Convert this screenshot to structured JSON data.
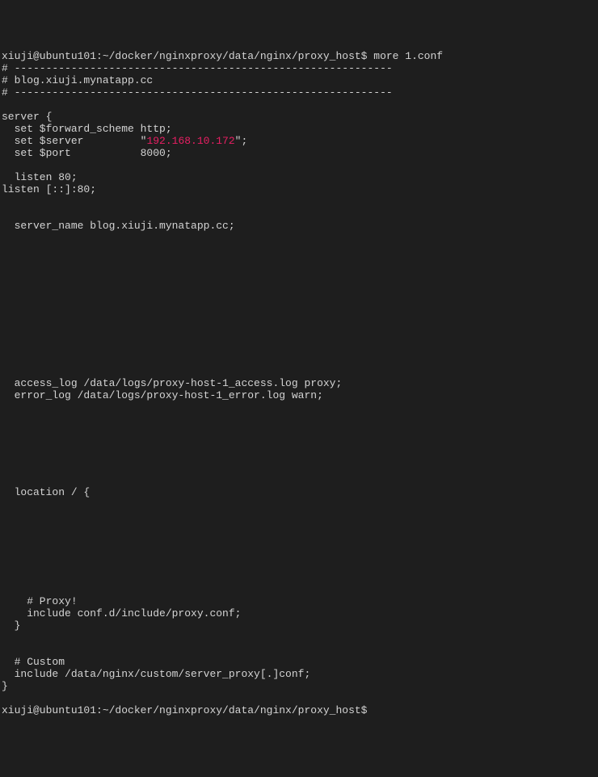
{
  "prompt1": "xiuji@ubuntu101:~/docker/nginxproxy/data/nginx/proxy_host$ more 1.conf",
  "line1": "# ------------------------------------------------------------",
  "line2": "# blog.xiuji.mynatapp.cc",
  "line3": "# ------------------------------------------------------------",
  "line4": "",
  "line5": "server {",
  "line6": "  set $forward_scheme http;",
  "line7_prefix": "  set $server         \"",
  "line7_ip": "192.168.10.172",
  "line7_suffix": "\";",
  "line8": "  set $port           8000;",
  "line9": "",
  "line10": "  listen 80;",
  "line11": "listen [::]:80;",
  "line12": "",
  "line13": "",
  "line14": "  server_name blog.xiuji.mynatapp.cc;",
  "line15": "",
  "line16": "",
  "line17": "",
  "line18": "",
  "line19": "",
  "line20": "",
  "line21": "",
  "line22": "",
  "line23": "",
  "line24": "",
  "line25": "",
  "line26": "",
  "line27": "  access_log /data/logs/proxy-host-1_access.log proxy;",
  "line28": "  error_log /data/logs/proxy-host-1_error.log warn;",
  "line29": "",
  "line30": "",
  "line31": "",
  "line32": "",
  "line33": "",
  "line34": "",
  "line35": "",
  "line36": "  location / {",
  "line37": "",
  "line38": "",
  "line39": "",
  "line40": "",
  "line41": "",
  "line42": "",
  "line43": "",
  "line44": "",
  "line45": "    # Proxy!",
  "line46": "    include conf.d/include/proxy.conf;",
  "line47": "  }",
  "line48": "",
  "line49": "",
  "line50": "  # Custom",
  "line51": "  include /data/nginx/custom/server_proxy[.]conf;",
  "line52": "}",
  "line53": "",
  "prompt2": "xiuji@ubuntu101:~/docker/nginxproxy/data/nginx/proxy_host$ "
}
